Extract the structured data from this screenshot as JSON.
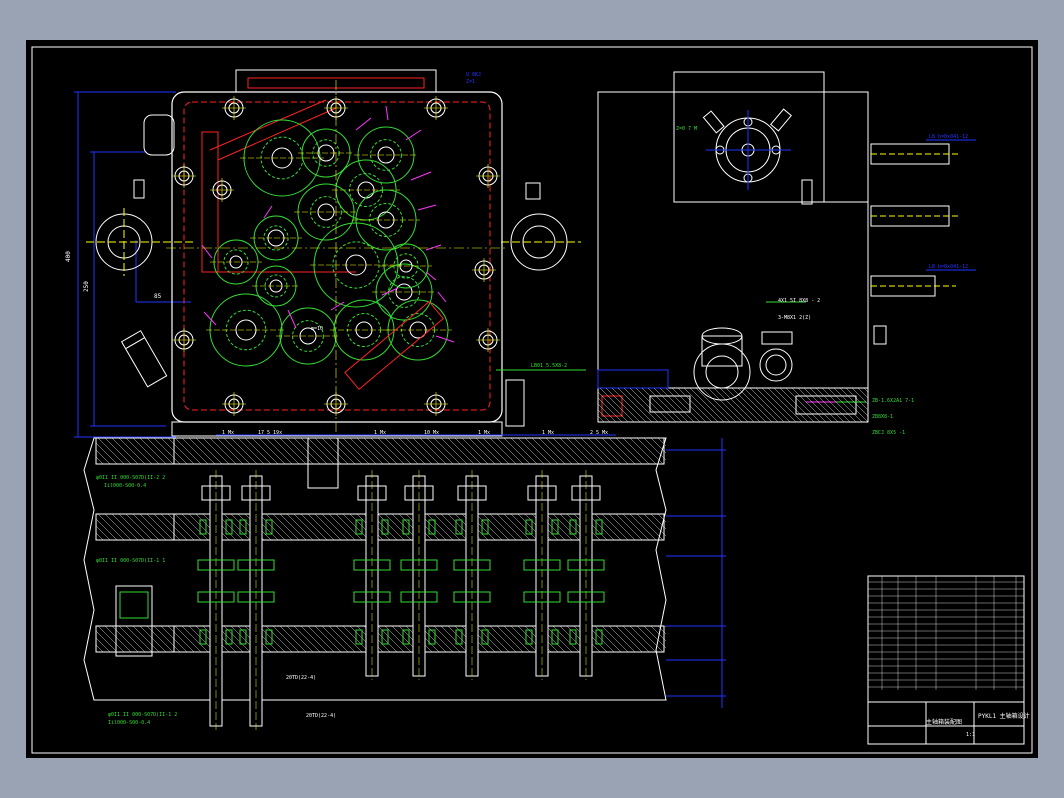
{
  "drawing": {
    "colors": {
      "background": "#000000",
      "viewport": "#9aa3b3",
      "outline": "#ffffff",
      "gears": "#33dd33",
      "dimension": "#2233ff",
      "housing_red": "#ff2222",
      "leader_magenta": "#ff33ff",
      "centerline_yellow": "#ffff00",
      "bolt_cyan": "#33dddd"
    },
    "labels": {
      "top_note": "U 8KJ",
      "top_note2": "Z=1",
      "flange_note": "LB01 5.5X8-2",
      "right_note1": "LB b=8x041-12",
      "right_note2": "LB b=8x041-12",
      "mid_note1": "4X1 5I 8X8 - 2",
      "mid_note2": "3-M8X1 2(Z)",
      "bot_note1": "ZB-1.6X2A1 7-1",
      "bot_note2": "ZB8X8-1",
      "bot_note3": "ZBCJ 8X5 -1",
      "left_dim1": "400",
      "left_dim2": "250",
      "left_dim3": "85",
      "gear_center": "m=10",
      "section_note1": "φ0I1 II 000-S07D(II-2 2",
      "section_note2": "Iil000-S00-0.4",
      "section_note3": "φ0I1 II 000-S07D(II-1 1",
      "section_note4": "φ0I1 II 000-S07D(II-1 2",
      "section_note5": "Iil000-S00-0.4",
      "shaft_note1": "20TD(22-4)",
      "shaft_note2": "20TD(22-4)",
      "angle_note": "Z=0 7 M"
    },
    "title_block": {
      "title": "PYKL1 主轴箱设计",
      "drawing_no": "主轴箱装配图",
      "scale": "1:1"
    }
  }
}
